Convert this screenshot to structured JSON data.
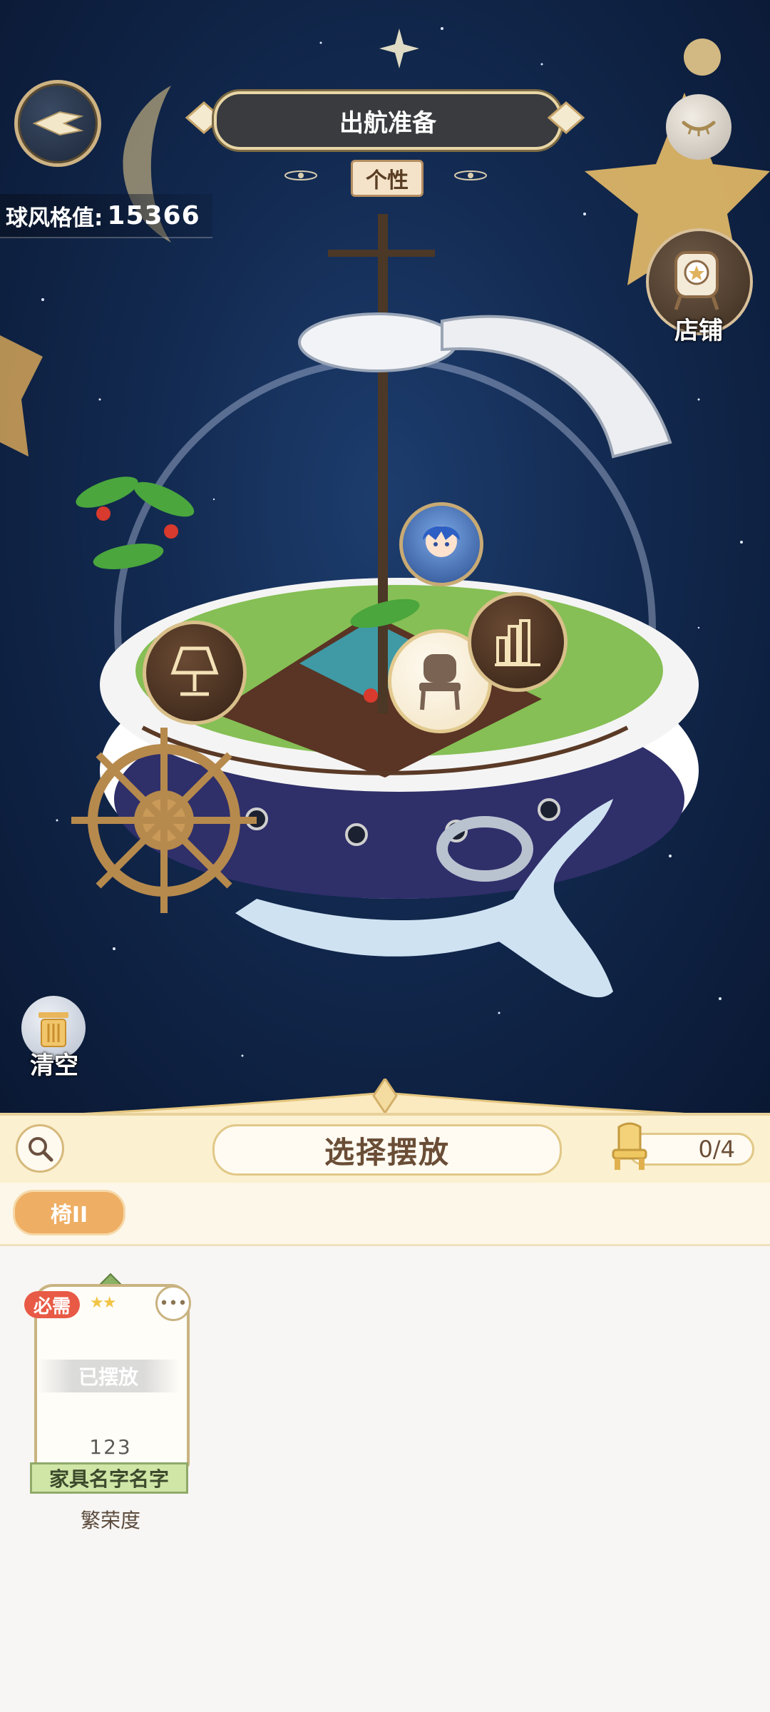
{
  "header": {
    "title": "出航准备",
    "tag": "个性"
  },
  "stats": {
    "style_label": "球风格值:",
    "style_value": "15366"
  },
  "side_buttons": {
    "shop_label": "店铺",
    "clear_label": "清空"
  },
  "scene": {
    "hotspots": [
      "lamp-icon",
      "chair-icon",
      "bookshelf-icon",
      "character-avatar"
    ]
  },
  "panel": {
    "title": "选择摆放",
    "count": "0/4",
    "filter_chip": "椅II"
  },
  "items": [
    {
      "badge": "必需",
      "stars": 2,
      "status": "已摆放",
      "value": "123",
      "name": "家具名字名字",
      "sub_label": "繁荣度"
    }
  ],
  "colors": {
    "panel_bg": "#fbf0cf",
    "chip": "#eeae63",
    "badge_red": "#e85a45",
    "name_band": "#cfe6a7"
  }
}
